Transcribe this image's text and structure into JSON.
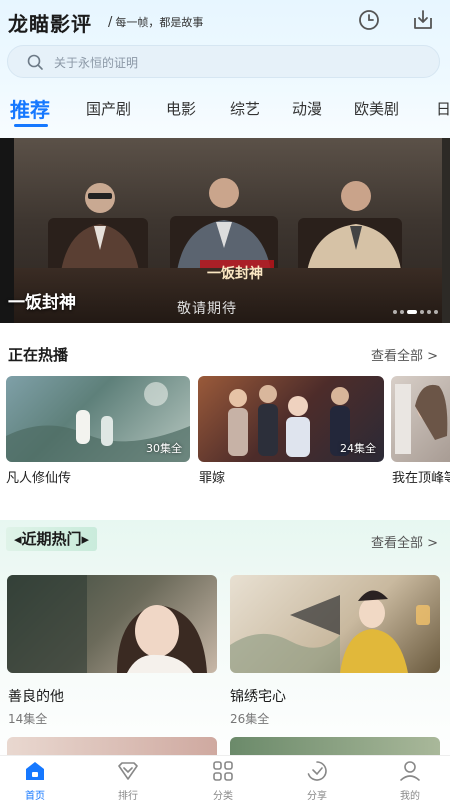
{
  "header": {
    "app_name": "龙瞄影评",
    "slogan": "每一帧，都是故事",
    "history_icon": "clock-icon",
    "download_icon": "download-icon"
  },
  "search": {
    "placeholder": "关于永恒的证明"
  },
  "tabs": [
    {
      "label": "推荐",
      "active": true
    },
    {
      "label": "国产剧"
    },
    {
      "label": "电影"
    },
    {
      "label": "综艺"
    },
    {
      "label": "动漫"
    },
    {
      "label": "欧美剧"
    },
    {
      "label": "日"
    }
  ],
  "banner": {
    "title": "一饭封神",
    "tagline": "敬请期待",
    "logo_text": "一饭封神",
    "dots_total": 6,
    "dots_active": 2
  },
  "now_playing": {
    "heading": "正在热播",
    "see_all": "查看全部 >",
    "items": [
      {
        "title": "凡人修仙传",
        "badge": "30集全"
      },
      {
        "title": "罪嫁",
        "badge": "24集全"
      },
      {
        "title": "我在顶峰等你",
        "badge": ""
      }
    ]
  },
  "recent_hot": {
    "heading": "近期热门",
    "see_all": "查看全部 >",
    "items": [
      {
        "title": "善良的他",
        "episodes": "14集全"
      },
      {
        "title": "锦绣宅心",
        "episodes": "26集全"
      }
    ]
  },
  "bottom_nav": [
    {
      "label": "首页",
      "icon": "home-icon",
      "active": true
    },
    {
      "label": "排行",
      "icon": "ranking-icon"
    },
    {
      "label": "分类",
      "icon": "category-icon"
    },
    {
      "label": "分享",
      "icon": "share-icon"
    },
    {
      "label": "我的",
      "icon": "profile-icon"
    }
  ],
  "colors": {
    "accent": "#1678ff",
    "header_bg": "#e7f6ff",
    "recent_bg": "#e7f7f1"
  }
}
